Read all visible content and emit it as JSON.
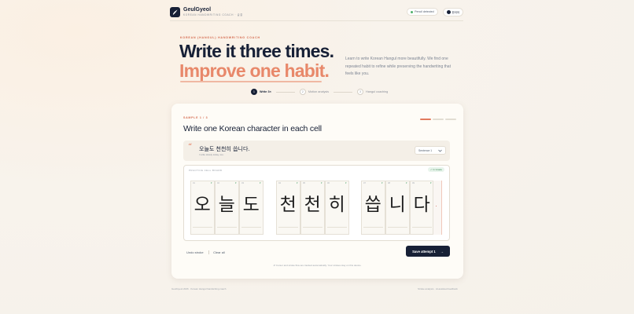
{
  "brand": {
    "title": "GeulGyeol",
    "subtitle": "KOREAN HANDWRITING COACH · 글결"
  },
  "header": {
    "status": "Pencil detected",
    "language": "한국어"
  },
  "hero": {
    "eyebrow": "KOREAN (HANGUL) HANDWRITING COACH",
    "line1": "Write it three times.",
    "line2": "Improve one habit.",
    "intro": "Learn to write Korean Hangul more beautifully. We find one repeated habit to refine while preserving the handwriting that feels like you."
  },
  "steps": [
    {
      "num": "1",
      "label": "Write 3×"
    },
    {
      "num": "2",
      "label": "Motion analysis"
    },
    {
      "num": "3",
      "label": "Hangul coaching"
    }
  ],
  "card": {
    "sample_label": "SAMPLE 1 / 3",
    "title": "Write one Korean character in each cell",
    "sentence": {
      "quote": "“",
      "ko": "오늘도 천천히 씁니다.",
      "en": "I write slowly today, too.",
      "select": "Sentence 1"
    },
    "practice": {
      "label": "PRACTICE CELL BOARD",
      "badge": "✓ In Grade"
    },
    "groups": [
      {
        "cells": [
          {
            "idx": "01",
            "char": "오"
          },
          {
            "idx": "02",
            "char": "늘"
          },
          {
            "idx": "03",
            "char": "도"
          }
        ]
      },
      {
        "cells": [
          {
            "idx": "04",
            "char": "천"
          },
          {
            "idx": "05",
            "char": "천"
          },
          {
            "idx": "06",
            "char": "히"
          }
        ]
      },
      {
        "cells": [
          {
            "idx": "07",
            "char": "씁"
          },
          {
            "idx": "08",
            "char": "니"
          },
          {
            "idx": "09",
            "char": "다"
          }
        ]
      }
    ],
    "actions": {
      "undo": "Undo stroke",
      "clear": "Clear all"
    },
    "save": {
      "label": "Save attempt 1",
      "arrow": "→"
    },
    "hint": "⇄ Cursor and stroke flow are tracked automatically. Your strokes stay on this device."
  },
  "footer": {
    "left": "GeulGyeol 2026 · Korean Hangul handwriting coach",
    "right": "Stroke analysis · AI-assisted feedback"
  },
  "progress": {
    "current": 1,
    "total": 3
  },
  "colors": {
    "accent": "#e27a5d",
    "navy": "#172036",
    "success": "#3f9a5e"
  }
}
